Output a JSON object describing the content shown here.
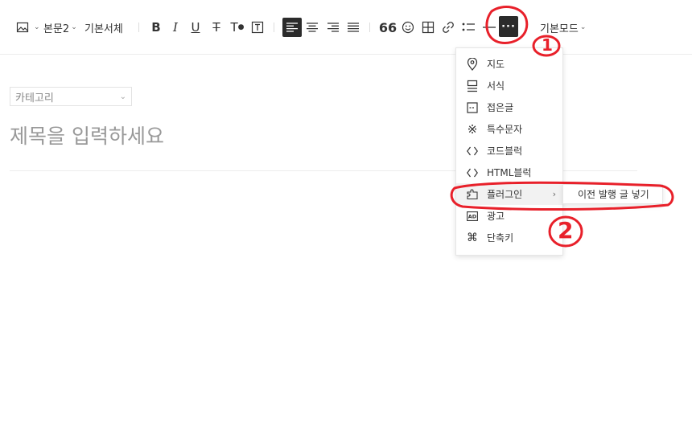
{
  "toolbar": {
    "image_icon": "image-icon",
    "paragraph_style": "본문2",
    "font_family": "기본서체",
    "mode": "기본모드",
    "more_label": "···"
  },
  "editor": {
    "category_placeholder": "카테고리",
    "title_placeholder": "제목을 입력하세요"
  },
  "more_menu": {
    "items": [
      {
        "icon": "map-pin-icon",
        "label": "지도"
      },
      {
        "icon": "format-icon",
        "label": "서식"
      },
      {
        "icon": "fold-icon",
        "label": "접은글"
      },
      {
        "icon": "special-char-icon",
        "label": "특수문자"
      },
      {
        "icon": "code-icon",
        "label": "코드블럭"
      },
      {
        "icon": "html-icon",
        "label": "HTML블럭"
      },
      {
        "icon": "plugin-icon",
        "label": "플러그인"
      },
      {
        "icon": "ad-icon",
        "label": "광고"
      },
      {
        "icon": "shortcut-icon",
        "label": "단축키"
      }
    ]
  },
  "plugin_submenu": {
    "items": [
      {
        "label": "이전 발행 글 넣기"
      }
    ]
  },
  "annotations": {
    "mark1": "1",
    "mark2": "2",
    "color": "#e8202a"
  }
}
